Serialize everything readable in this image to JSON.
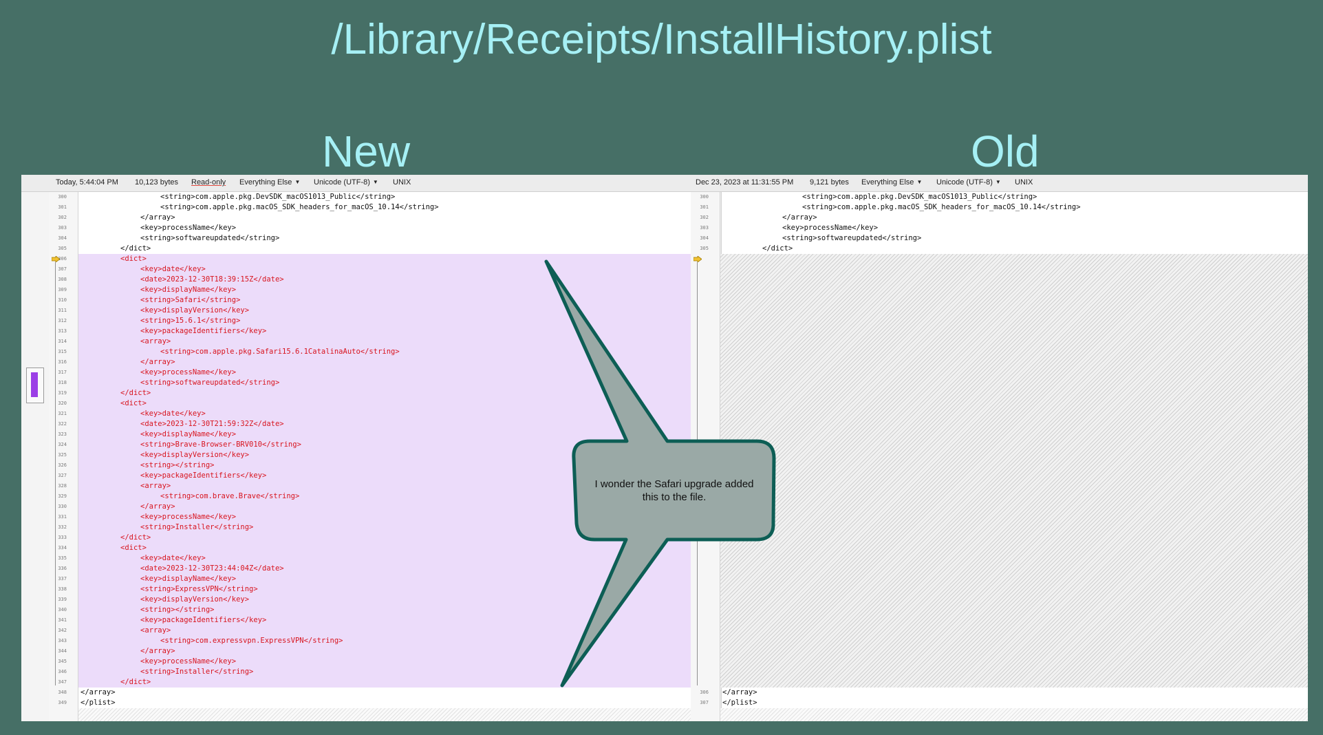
{
  "slide": {
    "title": "/Library/Receipts/InstallHistory.plist",
    "label_new": "New",
    "label_old": "Old"
  },
  "toolbar_left": {
    "date": "Today, 5:44:04 PM",
    "size": "10,123 bytes",
    "readonly": "Read-only",
    "syntax": "Everything Else",
    "encoding": "Unicode (UTF-8)",
    "line_endings": "UNIX"
  },
  "toolbar_right": {
    "date": "Dec 23, 2023 at 11:31:55 PM",
    "size": "9,121 bytes",
    "syntax": "Everything Else",
    "encoding": "Unicode (UTF-8)",
    "line_endings": "UNIX"
  },
  "left_lines": [
    {
      "n": "300",
      "indent": 4,
      "text": "<string>com.apple.pkg.DevSDK_macOS1013_Public</string>",
      "added": false
    },
    {
      "n": "301",
      "indent": 4,
      "text": "<string>com.apple.pkg.macOS_SDK_headers_for_macOS_10.14</string>",
      "added": false
    },
    {
      "n": "302",
      "indent": 3,
      "text": "</array>",
      "added": false
    },
    {
      "n": "303",
      "indent": 3,
      "text": "<key>processName</key>",
      "added": false
    },
    {
      "n": "304",
      "indent": 3,
      "text": "<string>softwareupdated</string>",
      "added": false
    },
    {
      "n": "305",
      "indent": 2,
      "text": "</dict>",
      "added": false
    },
    {
      "n": "306",
      "indent": 2,
      "text": "<dict>",
      "added": true
    },
    {
      "n": "307",
      "indent": 3,
      "text": "<key>date</key>",
      "added": true
    },
    {
      "n": "308",
      "indent": 3,
      "text": "<date>2023-12-30T18:39:15Z</date>",
      "added": true
    },
    {
      "n": "309",
      "indent": 3,
      "text": "<key>displayName</key>",
      "added": true
    },
    {
      "n": "310",
      "indent": 3,
      "text": "<string>Safari</string>",
      "added": true
    },
    {
      "n": "311",
      "indent": 3,
      "text": "<key>displayVersion</key>",
      "added": true
    },
    {
      "n": "312",
      "indent": 3,
      "text": "<string>15.6.1</string>",
      "added": true
    },
    {
      "n": "313",
      "indent": 3,
      "text": "<key>packageIdentifiers</key>",
      "added": true
    },
    {
      "n": "314",
      "indent": 3,
      "text": "<array>",
      "added": true
    },
    {
      "n": "315",
      "indent": 4,
      "text": "<string>com.apple.pkg.Safari15.6.1CatalinaAuto</string>",
      "added": true
    },
    {
      "n": "316",
      "indent": 3,
      "text": "</array>",
      "added": true
    },
    {
      "n": "317",
      "indent": 3,
      "text": "<key>processName</key>",
      "added": true
    },
    {
      "n": "318",
      "indent": 3,
      "text": "<string>softwareupdated</string>",
      "added": true
    },
    {
      "n": "319",
      "indent": 2,
      "text": "</dict>",
      "added": true
    },
    {
      "n": "320",
      "indent": 2,
      "text": "<dict>",
      "added": true
    },
    {
      "n": "321",
      "indent": 3,
      "text": "<key>date</key>",
      "added": true
    },
    {
      "n": "322",
      "indent": 3,
      "text": "<date>2023-12-30T21:59:32Z</date>",
      "added": true
    },
    {
      "n": "323",
      "indent": 3,
      "text": "<key>displayName</key>",
      "added": true
    },
    {
      "n": "324",
      "indent": 3,
      "text": "<string>Brave-Browser-BRV010</string>",
      "added": true
    },
    {
      "n": "325",
      "indent": 3,
      "text": "<key>displayVersion</key>",
      "added": true
    },
    {
      "n": "326",
      "indent": 3,
      "text": "<string></string>",
      "added": true
    },
    {
      "n": "327",
      "indent": 3,
      "text": "<key>packageIdentifiers</key>",
      "added": true
    },
    {
      "n": "328",
      "indent": 3,
      "text": "<array>",
      "added": true
    },
    {
      "n": "329",
      "indent": 4,
      "text": "<string>com.brave.Brave</string>",
      "added": true
    },
    {
      "n": "330",
      "indent": 3,
      "text": "</array>",
      "added": true
    },
    {
      "n": "331",
      "indent": 3,
      "text": "<key>processName</key>",
      "added": true
    },
    {
      "n": "332",
      "indent": 3,
      "text": "<string>Installer</string>",
      "added": true
    },
    {
      "n": "333",
      "indent": 2,
      "text": "</dict>",
      "added": true
    },
    {
      "n": "334",
      "indent": 2,
      "text": "<dict>",
      "added": true
    },
    {
      "n": "335",
      "indent": 3,
      "text": "<key>date</key>",
      "added": true
    },
    {
      "n": "336",
      "indent": 3,
      "text": "<date>2023-12-30T23:44:04Z</date>",
      "added": true
    },
    {
      "n": "337",
      "indent": 3,
      "text": "<key>displayName</key>",
      "added": true
    },
    {
      "n": "338",
      "indent": 3,
      "text": "<string>ExpressVPN</string>",
      "added": true
    },
    {
      "n": "339",
      "indent": 3,
      "text": "<key>displayVersion</key>",
      "added": true
    },
    {
      "n": "340",
      "indent": 3,
      "text": "<string></string>",
      "added": true
    },
    {
      "n": "341",
      "indent": 3,
      "text": "<key>packageIdentifiers</key>",
      "added": true
    },
    {
      "n": "342",
      "indent": 3,
      "text": "<array>",
      "added": true
    },
    {
      "n": "343",
      "indent": 4,
      "text": "<string>com.expressvpn.ExpressVPN</string>",
      "added": true
    },
    {
      "n": "344",
      "indent": 3,
      "text": "</array>",
      "added": true
    },
    {
      "n": "345",
      "indent": 3,
      "text": "<key>processName</key>",
      "added": true
    },
    {
      "n": "346",
      "indent": 3,
      "text": "<string>Installer</string>",
      "added": true
    },
    {
      "n": "347",
      "indent": 2,
      "text": "</dict>",
      "added": true
    },
    {
      "n": "348",
      "indent": 0,
      "text": "</array>",
      "added": false
    },
    {
      "n": "349",
      "indent": 0,
      "text": "</plist>",
      "added": false
    }
  ],
  "right_lines_top": [
    {
      "n": "300",
      "indent": 4,
      "text": "<string>com.apple.pkg.DevSDK_macOS1013_Public</string>"
    },
    {
      "n": "301",
      "indent": 4,
      "text": "<string>com.apple.pkg.macOS_SDK_headers_for_macOS_10.14</string>"
    },
    {
      "n": "302",
      "indent": 3,
      "text": "</array>"
    },
    {
      "n": "303",
      "indent": 3,
      "text": "<key>processName</key>"
    },
    {
      "n": "304",
      "indent": 3,
      "text": "<string>softwareupdated</string>"
    },
    {
      "n": "305",
      "indent": 2,
      "text": "</dict>"
    }
  ],
  "right_lines_bottom": [
    {
      "n": "306",
      "indent": 0,
      "text": "</array>"
    },
    {
      "n": "307",
      "indent": 0,
      "text": "</plist>"
    }
  ],
  "callout": {
    "line1": "I wonder the Safari upgrade added",
    "line2": "this to the file."
  },
  "colors": {
    "background": "#466f66",
    "title": "#a6f0f5",
    "added_text": "#d8141e",
    "added_bg": "#ecdcfa",
    "callout_fill": "#9aa9a6",
    "callout_stroke": "#0d5e55"
  }
}
